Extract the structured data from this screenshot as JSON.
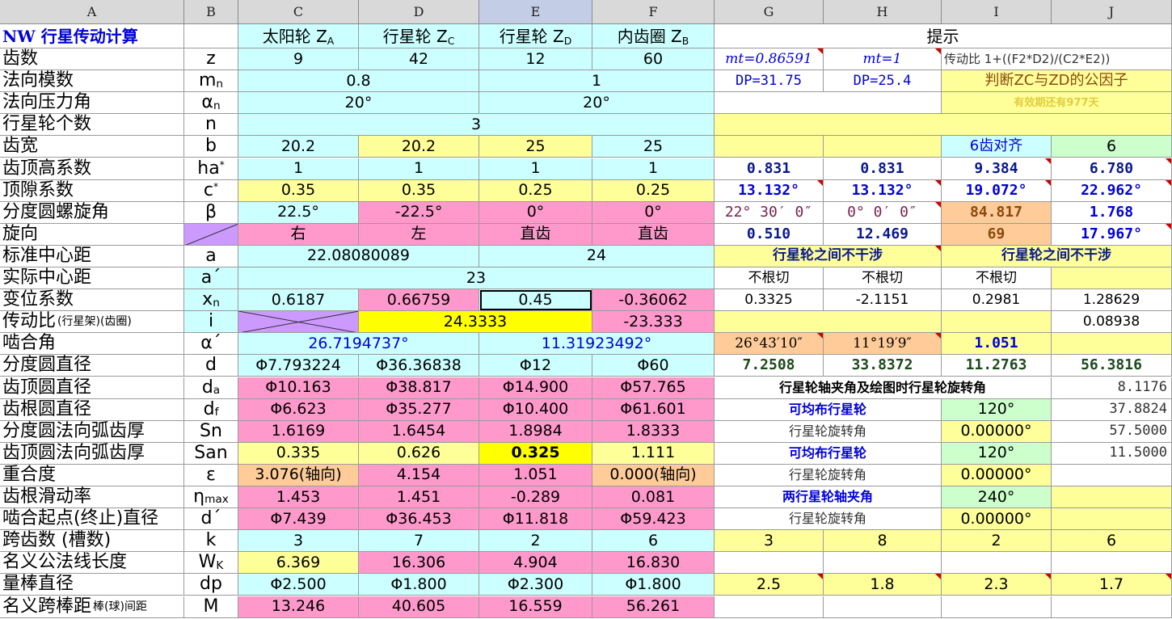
{
  "colors": {
    "cyan": "#ccffff",
    "pink": "#ff99cc",
    "yellow": "#ffff99",
    "yellow_bright": "#ffff00",
    "orange": "#ffcc99",
    "green": "#ccffcc",
    "lavender": "#cc99ff",
    "white": "#ffffff",
    "header": "#d9d9d9"
  },
  "column_headers": [
    "A",
    "B",
    "C",
    "D",
    "E",
    "F",
    "G",
    "H",
    "I",
    "J"
  ],
  "sheet": {
    "r1": {
      "A": "NW 行星传动计算",
      "C": [
        "太阳轮 Z",
        "A"
      ],
      "D": [
        "行星轮 Z",
        "C"
      ],
      "E": [
        "行星轮 Z",
        "D"
      ],
      "F": [
        "内齿圈 Z",
        "B"
      ],
      "GJ": "提示"
    },
    "r2": {
      "A": "齿数",
      "B": "z",
      "C": "9",
      "D": "42",
      "E": "12",
      "F": "60",
      "G": "mt=0.86591",
      "H": "mt=1",
      "IJ": "传动比 1+((F2*D2)/(C2*E2))"
    },
    "r3": {
      "A": "法向模数",
      "B": [
        "m",
        "n"
      ],
      "CD": "0.8",
      "EF": "1",
      "G": "DP=31.75",
      "H": "DP=25.4",
      "IJ": "判断ZC与ZD的公因子"
    },
    "r4": {
      "A": "法向压力角",
      "B": [
        "α",
        "n"
      ],
      "CD": "20°",
      "EF": "20°",
      "IJ": "有效期还有977天"
    },
    "r5": {
      "A": "行星轮个数",
      "B": "n",
      "CF": "3"
    },
    "r6": {
      "A": "齿宽",
      "B": "b",
      "C": "20.2",
      "D": "20.2",
      "E": "25",
      "F": "25",
      "I": "6齿对齐",
      "J": "6"
    },
    "r7": {
      "A": "齿顶高系数",
      "B": [
        "ha",
        "*"
      ],
      "C": "1",
      "D": "1",
      "E": "1",
      "F": "1",
      "G": "0.831",
      "H": "0.831",
      "I": "9.384",
      "J": "6.780"
    },
    "r8": {
      "A": "顶隙系数",
      "B": [
        "c",
        "*"
      ],
      "C": "0.35",
      "D": "0.35",
      "E": "0.25",
      "F": "0.25",
      "G": "13.132°",
      "H": "13.132°",
      "I": "19.072°",
      "J": "22.962°"
    },
    "r9": {
      "A": "分度圆螺旋角",
      "B": "β",
      "C": "22.5°",
      "D": "-22.5°",
      "E": "0°",
      "F": "0°",
      "G": "22° 30′ 0″",
      "H": "0° 0′ 0″",
      "I": "84.817",
      "J": "1.768"
    },
    "r10": {
      "A": "旋向",
      "C": "右",
      "D": "左",
      "E": "直齿",
      "F": "直齿",
      "G": "0.510",
      "H": "12.469",
      "I": "69",
      "J": "17.967°"
    },
    "r11": {
      "A": "标准中心距",
      "B": "a",
      "CD": "22.08080089",
      "EF": "24",
      "GH": "行星轮之间不干涉",
      "IJ": "行星轮之间不干涉"
    },
    "r12": {
      "A": "实际中心距",
      "B": "a´",
      "CF": "23",
      "G": "不根切",
      "H": "不根切",
      "I": "不根切"
    },
    "r13": {
      "A": "变位系数",
      "B": [
        "x",
        "n"
      ],
      "C": "0.6187",
      "D": "0.66759",
      "E": "0.45",
      "F": "-0.36062",
      "G": "0.3325",
      "H": "-2.1151",
      "I": "0.2981",
      "J": "1.28629"
    },
    "r14": {
      "A": [
        "传动比",
        "(行星架)(齿圈)"
      ],
      "B": "i",
      "DE": "24.3333",
      "F": "-23.333",
      "J": "0.08938"
    },
    "r15": {
      "A": "啮合角",
      "B": "α´",
      "CD": "26.7194737°",
      "EF": "11.31923492°",
      "G": "26°43′10″",
      "H": "11°19′9″",
      "I": "1.051"
    },
    "r16": {
      "A": "分度圆直径",
      "B": "d",
      "C": "Φ7.793224",
      "D": "Φ36.36838",
      "E": "Φ12",
      "F": "Φ60",
      "G": "7.2508",
      "H": "33.8372",
      "I": "11.2763",
      "J": "56.3816"
    },
    "r17": {
      "A": "齿顶圆直径",
      "B": [
        "d",
        "a"
      ],
      "C": "Φ10.163",
      "D": "Φ38.817",
      "E": "Φ14.900",
      "F": "Φ57.765",
      "GI": "行星轮轴夹角及绘图时行星轮旋转角",
      "J": "8.1176"
    },
    "r18": {
      "A": "齿根圆直径",
      "B": [
        "d",
        "f"
      ],
      "C": "Φ6.623",
      "D": "Φ35.277",
      "E": "Φ10.400",
      "F": "Φ61.601",
      "GH": "可均布行星轮",
      "I": "120°",
      "J": "37.8824"
    },
    "r19": {
      "A": "分度圆法向弧齿厚",
      "B": "Sn",
      "C": "1.6169",
      "D": "1.6454",
      "E": "1.8984",
      "F": "1.8333",
      "GH": "行星轮旋转角",
      "I": "0.00000°",
      "J": "57.5000"
    },
    "r20": {
      "A": "齿顶圆法向弧齿厚",
      "B": "San",
      "C": "0.335",
      "D": "0.626",
      "E": "0.325",
      "F": "1.111",
      "GH": "可均布行星轮",
      "I": "120°",
      "J": "11.5000"
    },
    "r21": {
      "A": "重合度",
      "B": "ε",
      "C": "3.076(轴向)",
      "D": "4.154",
      "E": "1.051",
      "F": "0.000(轴向)",
      "GH": "行星轮旋转角",
      "I": "0.00000°"
    },
    "r22": {
      "A": "齿根滑动率",
      "B": [
        "η",
        "max"
      ],
      "C": "1.453",
      "D": "1.451",
      "E": "-0.289",
      "F": "0.081",
      "GH": "两行星轮轴夹角",
      "I": "240°"
    },
    "r23": {
      "A": "啮合起点(终止)直径",
      "B": "d´",
      "C": "Φ7.439",
      "D": "Φ36.453",
      "E": "Φ11.818",
      "F": "Φ59.423",
      "GH": "行星轮旋转角",
      "I": "0.00000°"
    },
    "r24": {
      "A": "跨齿数 (槽数)",
      "B": "k",
      "C": "3",
      "D": "7",
      "E": "2",
      "F": "6",
      "G": "3",
      "H": "8",
      "I": "2",
      "J": "6"
    },
    "r25": {
      "A": "名义公法线长度",
      "B": [
        "W",
        "K"
      ],
      "C": "6.369",
      "D": "16.306",
      "E": "4.904",
      "F": "16.830"
    },
    "r26": {
      "A": "量棒直径",
      "B": "dp",
      "C": "Φ2.500",
      "D": "Φ1.800",
      "E": "Φ2.300",
      "F": "Φ1.800",
      "G": "2.5",
      "H": "1.8",
      "I": "2.3",
      "J": "1.7"
    },
    "r27": {
      "A": [
        "名义跨棒距",
        "棒(球)间距"
      ],
      "B": "M",
      "C": "13.246",
      "D": "40.605",
      "E": "16.559",
      "F": "56.261"
    }
  }
}
